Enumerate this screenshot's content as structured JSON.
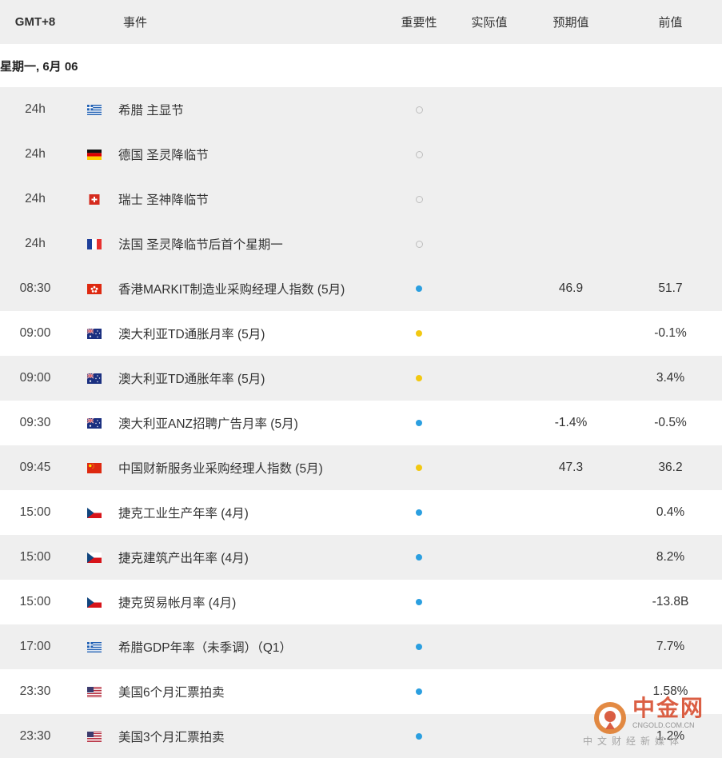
{
  "header": {
    "timezone": "GMT+8",
    "event": "事件",
    "importance": "重要性",
    "actual": "实际值",
    "forecast": "预期值",
    "previous": "前值"
  },
  "date_label": "星期一, 6月 06",
  "rows": [
    {
      "time": "24h",
      "flag": "greece-flag",
      "event": "希腊 主显节",
      "importance": "none",
      "actual": "",
      "forecast": "",
      "previous": ""
    },
    {
      "time": "24h",
      "flag": "germany-flag",
      "event": "德国 圣灵降临节",
      "importance": "none",
      "actual": "",
      "forecast": "",
      "previous": ""
    },
    {
      "time": "24h",
      "flag": "switzerland-flag",
      "event": "瑞士 圣神降临节",
      "importance": "none",
      "actual": "",
      "forecast": "",
      "previous": ""
    },
    {
      "time": "24h",
      "flag": "france-flag",
      "event": "法国 圣灵降临节后首个星期一",
      "importance": "none",
      "actual": "",
      "forecast": "",
      "previous": ""
    },
    {
      "time": "08:30",
      "flag": "hongkong-flag",
      "event": "香港MARKIT制造业采购经理人指数 (5月)",
      "importance": "blue",
      "actual": "",
      "forecast": "46.9",
      "previous": "51.7"
    },
    {
      "time": "09:00",
      "flag": "australia-flag",
      "event": "澳大利亚TD通胀月率 (5月)",
      "importance": "yellow",
      "actual": "",
      "forecast": "",
      "previous": "-0.1%"
    },
    {
      "time": "09:00",
      "flag": "australia-flag",
      "event": "澳大利亚TD通胀年率 (5月)",
      "importance": "yellow",
      "actual": "",
      "forecast": "",
      "previous": "3.4%"
    },
    {
      "time": "09:30",
      "flag": "australia-flag",
      "event": "澳大利亚ANZ招聘广告月率 (5月)",
      "importance": "blue",
      "actual": "",
      "forecast": "-1.4%",
      "previous": "-0.5%"
    },
    {
      "time": "09:45",
      "flag": "china-flag",
      "event": "中国财新服务业采购经理人指数 (5月)",
      "importance": "yellow",
      "actual": "",
      "forecast": "47.3",
      "previous": "36.2"
    },
    {
      "time": "15:00",
      "flag": "czech-flag",
      "event": "捷克工业生产年率 (4月)",
      "importance": "blue",
      "actual": "",
      "forecast": "",
      "previous": "0.4%"
    },
    {
      "time": "15:00",
      "flag": "czech-flag",
      "event": "捷克建筑产出年率 (4月)",
      "importance": "blue",
      "actual": "",
      "forecast": "",
      "previous": "8.2%"
    },
    {
      "time": "15:00",
      "flag": "czech-flag",
      "event": "捷克贸易帐月率 (4月)",
      "importance": "blue",
      "actual": "",
      "forecast": "",
      "previous": "-13.8B"
    },
    {
      "time": "17:00",
      "flag": "greece-flag",
      "event": "希腊GDP年率（未季调）（Q1）",
      "importance": "blue",
      "actual": "",
      "forecast": "",
      "previous": "7.7%"
    },
    {
      "time": "23:30",
      "flag": "usa-flag",
      "event": "美国6个月汇票拍卖",
      "importance": "blue",
      "actual": "",
      "forecast": "",
      "previous": "1.58%"
    },
    {
      "time": "23:30",
      "flag": "usa-flag",
      "event": "美国3个月汇票拍卖",
      "importance": "blue",
      "actual": "",
      "forecast": "",
      "previous": "1.2%"
    }
  ],
  "watermark": {
    "name": "中金网",
    "domain": "CNGOLD.COM.CN",
    "tagline": "中文财经新媒体"
  },
  "colors": {
    "header_bg": "#efefef",
    "row_shade": "#efefef",
    "importance_blue": "#2b9fe0",
    "importance_yellow": "#f2c811",
    "importance_none": "#bdbdbd",
    "watermark_red": "#d74a2b"
  }
}
